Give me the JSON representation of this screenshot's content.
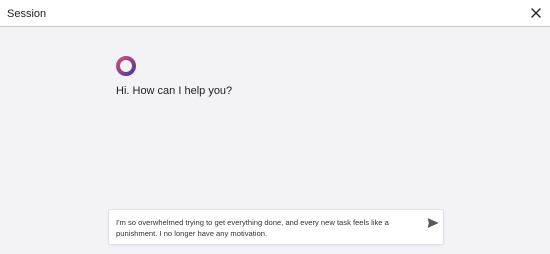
{
  "header": {
    "title": "Session",
    "close_icon": "close-icon"
  },
  "assistant": {
    "avatar_icon": "assistant-ring-icon",
    "greeting": "Hi. How can I help you?"
  },
  "composer": {
    "value": "I'm so overwhelmed trying to get everything done, and every new task feels like a punishment. I no longer have any motivation.",
    "send_icon": "send-icon"
  },
  "colors": {
    "background": "#f3f2f7",
    "header_background": "#ffffff",
    "avatar_gradient_start": "#d0507a",
    "avatar_gradient_end": "#4a3a9a"
  }
}
